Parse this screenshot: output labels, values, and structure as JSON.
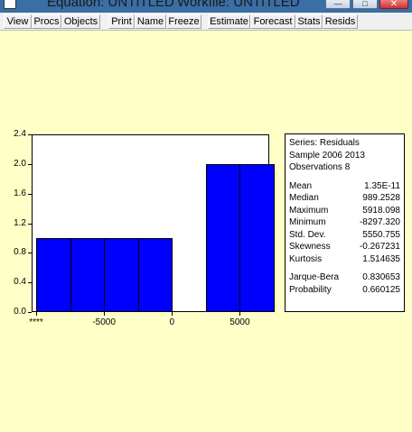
{
  "window": {
    "title": "Equation: UNTITLED",
    "workfile": "Workfile: UNTITLED",
    "minimize_glyph": "—",
    "maximize_glyph": "□",
    "close_glyph": "✕"
  },
  "toolbar": {
    "buttons": [
      "View",
      "Procs",
      "Objects",
      "Print",
      "Name",
      "Freeze",
      "Estimate",
      "Forecast",
      "Stats",
      "Resids"
    ]
  },
  "chart_data": {
    "type": "bar",
    "title": "",
    "xlabel": "",
    "ylabel": "",
    "bins": [
      {
        "from": -10000,
        "to": -7500,
        "count": 1
      },
      {
        "from": -7500,
        "to": -5000,
        "count": 1
      },
      {
        "from": -5000,
        "to": -2500,
        "count": 1
      },
      {
        "from": -2500,
        "to": 0,
        "count": 1
      },
      {
        "from": 0,
        "to": 2500,
        "count": 0
      },
      {
        "from": 2500,
        "to": 5000,
        "count": 2
      },
      {
        "from": 5000,
        "to": 7500,
        "count": 2
      }
    ],
    "xlim": [
      -10000,
      7500
    ],
    "ylim": [
      0,
      2.4
    ],
    "y_ticks": [
      "0.0",
      "0.4",
      "0.8",
      "1.2",
      "1.6",
      "2.0",
      "2.4"
    ],
    "x_ticks": [
      {
        "value": -10000,
        "label": "****"
      },
      {
        "value": -5000,
        "label": "-5000"
      },
      {
        "value": 0,
        "label": "0"
      },
      {
        "value": 5000,
        "label": "5000"
      }
    ],
    "bar_color": "#0000ff"
  },
  "stats": {
    "header": [
      {
        "label": "Series: Residuals"
      },
      {
        "label": "Sample 2006 2013"
      },
      {
        "label": "Observations 8"
      }
    ],
    "group1": [
      {
        "label": "Mean",
        "value": "1.35E-11"
      },
      {
        "label": "Median",
        "value": "989.2528"
      },
      {
        "label": "Maximum",
        "value": "5918.098"
      },
      {
        "label": "Minimum",
        "value": "-8297.320"
      },
      {
        "label": "Std. Dev.",
        "value": "5550.755"
      },
      {
        "label": "Skewness",
        "value": "-0.267231"
      },
      {
        "label": "Kurtosis",
        "value": "1.514635"
      }
    ],
    "group2": [
      {
        "label": "Jarque-Bera",
        "value": "0.830653"
      },
      {
        "label": "Probability",
        "value": "0.660125"
      }
    ]
  },
  "colors": {
    "background": "#ffffc8",
    "bar": "#0000ff",
    "titlebar": "#3a6ea5"
  }
}
